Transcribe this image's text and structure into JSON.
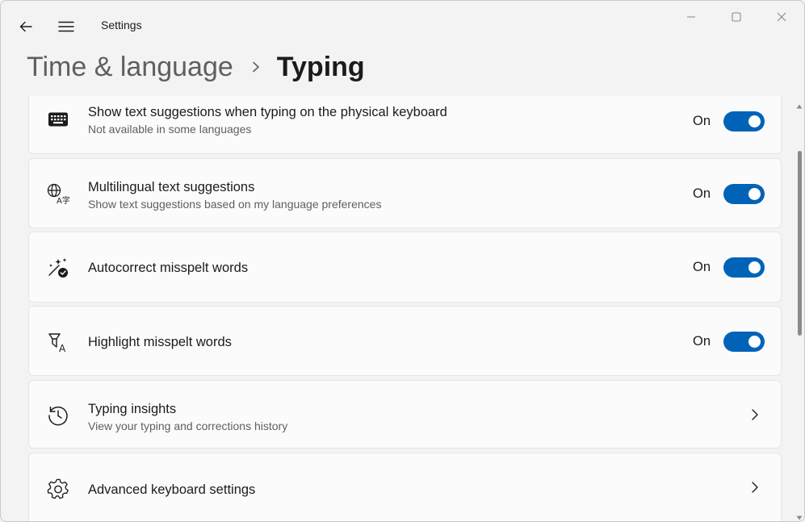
{
  "app": {
    "title": "Settings"
  },
  "breadcrumb": {
    "parent": "Time & language",
    "current": "Typing"
  },
  "settings": [
    {
      "icon": "keyboard-icon",
      "title": "Show text suggestions when typing on the physical keyboard",
      "subtitle": "Not available in some languages",
      "state": "On",
      "control": "toggle"
    },
    {
      "icon": "language-icon",
      "title": "Multilingual text suggestions",
      "subtitle": "Show text suggestions based on my language preferences",
      "state": "On",
      "control": "toggle"
    },
    {
      "icon": "autocorrect-icon",
      "title": "Autocorrect misspelt words",
      "subtitle": "",
      "state": "On",
      "control": "toggle"
    },
    {
      "icon": "highlight-spelling-icon",
      "title": "Highlight misspelt words",
      "subtitle": "",
      "state": "On",
      "control": "toggle"
    },
    {
      "icon": "history-icon",
      "title": "Typing insights",
      "subtitle": "View your typing and corrections history",
      "state": "",
      "control": "chevron"
    },
    {
      "icon": "gear-icon",
      "title": "Advanced keyboard settings",
      "subtitle": "",
      "state": "",
      "control": "chevron"
    }
  ],
  "colors": {
    "accent": "#0063b8",
    "background": "#f3f3f3",
    "card": "#fbfbfb"
  }
}
